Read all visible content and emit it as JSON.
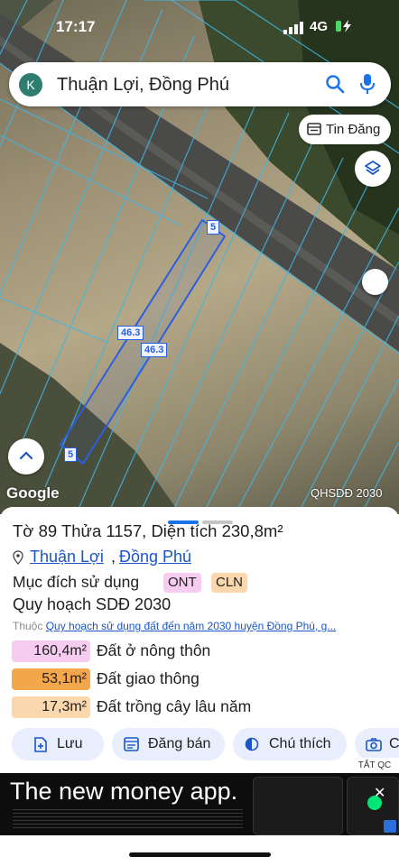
{
  "status_bar": {
    "time": "17:17",
    "network": "4G"
  },
  "search": {
    "avatar_letter": "K",
    "query": "Thuận Lợi, Đồng Phú"
  },
  "map": {
    "tin_dang_label": "Tin Đăng",
    "attribution": "Google",
    "layer_label": "QHSDĐ 2030",
    "dimensions": {
      "top": "5",
      "bottom": "5",
      "left": "46.3",
      "right": "46.3"
    }
  },
  "sheet": {
    "title": {
      "to_label": "Tờ",
      "to_value": "89",
      "thua_label": "Thửa",
      "thua_value": "1157",
      "dt_label": ", Diện tích",
      "dt_value": "230,8m²"
    },
    "location": {
      "ward": "Thuận Lợi",
      "separator": ",",
      "district": "Đồng Phú"
    },
    "purpose_label": "Mục đích sử dụng",
    "purpose_tags": [
      "ONT",
      "CLN"
    ],
    "planning_label": "Quy hoạch SDĐ 2030",
    "belongs_prefix": "Thuộc",
    "belongs_link": "Quy hoạch sử dụng đất đến năm 2030 huyện Đồng Phú, g...",
    "areas": [
      {
        "value": "160,4m²",
        "label": "Đất ở nông thôn",
        "color": "#f6cdf1"
      },
      {
        "value": "53,1m²",
        "label": "Đất giao thông",
        "color": "#f3a64a"
      },
      {
        "value": "17,3m²",
        "label": "Đất trồng cây lâu năm",
        "color": "#fbd7ad"
      }
    ],
    "actions": [
      {
        "label": "Lưu",
        "icon": "save-icon"
      },
      {
        "label": "Đăng bán",
        "icon": "listing-icon"
      },
      {
        "label": "Chú thích",
        "icon": "legend-icon"
      },
      {
        "label": "C",
        "icon": "camera-icon"
      }
    ]
  },
  "ad": {
    "headline": "The new money app.",
    "close_label": "TẮT QC",
    "close_glyph": "✕"
  },
  "colors": {
    "accent": "#1a73e8",
    "plot_line": "#2c5fe0",
    "parcel_line": "#3fb6e6"
  }
}
